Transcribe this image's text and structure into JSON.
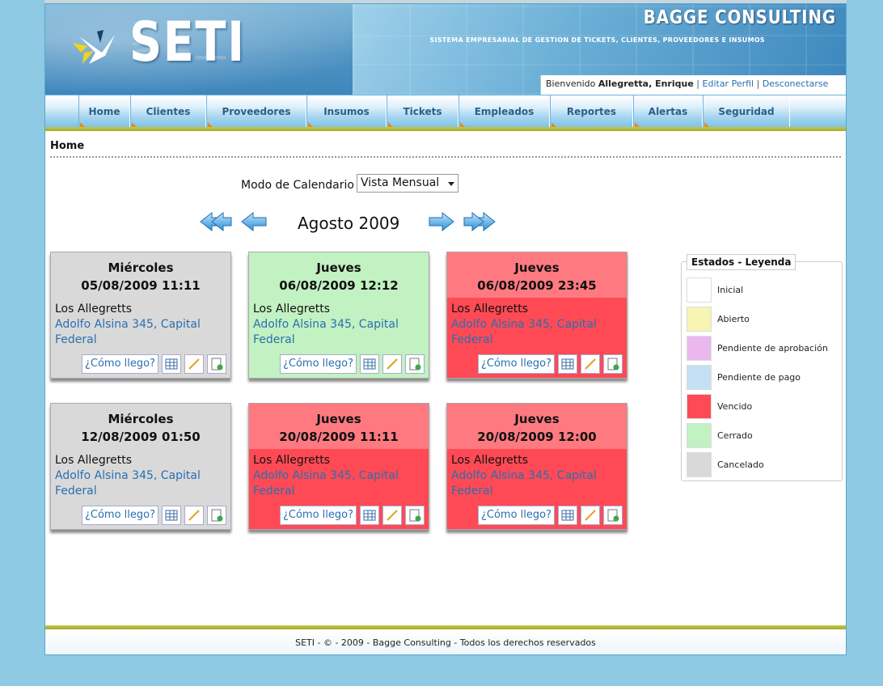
{
  "header": {
    "logo": "SETI",
    "company": "BAGGE CONSULTING",
    "subtitle": "SISTEMA EMPRESARIAL DE GESTION DE TICKETS, CLIENTES, PROVEEDORES E INSUMOS",
    "welcome": "Bienvenido",
    "user": "Allegretta, Enrique",
    "edit_profile": "Editar Perfil",
    "logout": "Desconectarse",
    "separator": "|"
  },
  "nav": [
    "Home",
    "Clientes",
    "Proveedores",
    "Insumos",
    "Tickets",
    "Empleados",
    "Reportes",
    "Alertas",
    "Seguridad"
  ],
  "breadcrumb": "Home",
  "calendar": {
    "mode_label": "Modo de Calendario",
    "mode_value": "Vista Mensual",
    "month": "Agosto 2009"
  },
  "cards": [
    {
      "day": "Miércoles",
      "datetime": "05/08/2009 11:11",
      "name": "Los Allegretts",
      "addr1": "Adolfo Alsina 345, Capital",
      "addr2": "Federal",
      "action": "¿Cómo llego?",
      "status": "gray"
    },
    {
      "day": "Jueves",
      "datetime": "06/08/2009 12:12",
      "name": "Los Allegretts",
      "addr1": "Adolfo Alsina 345, Capital",
      "addr2": "Federal",
      "action": "¿Cómo llego?",
      "status": "green"
    },
    {
      "day": "Jueves",
      "datetime": "06/08/2009 23:45",
      "name": "Los Allegretts",
      "addr1": "Adolfo Alsina 345, Capital",
      "addr2": "Federal",
      "action": "¿Cómo llego?",
      "status": "red"
    },
    {
      "day": "Miércoles",
      "datetime": "12/08/2009 01:50",
      "name": "Los Allegretts",
      "addr1": "Adolfo Alsina 345, Capital",
      "addr2": "Federal",
      "action": "¿Cómo llego?",
      "status": "gray"
    },
    {
      "day": "Jueves",
      "datetime": "20/08/2009 11:11",
      "name": "Los Allegretts",
      "addr1": "Adolfo Alsina 345, Capital",
      "addr2": "Federal",
      "action": "¿Cómo llego?",
      "status": "red"
    },
    {
      "day": "Jueves",
      "datetime": "20/08/2009 12:00",
      "name": "Los Allegretts",
      "addr1": "Adolfo Alsina 345, Capital",
      "addr2": "Federal",
      "action": "¿Cómo llego?",
      "status": "red"
    }
  ],
  "legend": {
    "title": "Estados - Leyenda",
    "items": [
      {
        "label": "Inicial",
        "color": "#ffffff"
      },
      {
        "label": "Abierto",
        "color": "#f7f4b4"
      },
      {
        "label": "Pendiente de aprobación",
        "color": "#eab8ee"
      },
      {
        "label": "Pendiente de pago",
        "color": "#c5e0f4"
      },
      {
        "label": "Vencido",
        "color": "#ff4a55"
      },
      {
        "label": "Cerrado",
        "color": "#c2f1c2"
      },
      {
        "label": "Cancelado",
        "color": "#d9d9d9"
      }
    ]
  },
  "footer": "SETI - © - 2009 - Bagge Consulting - Todos los derechos reservados"
}
